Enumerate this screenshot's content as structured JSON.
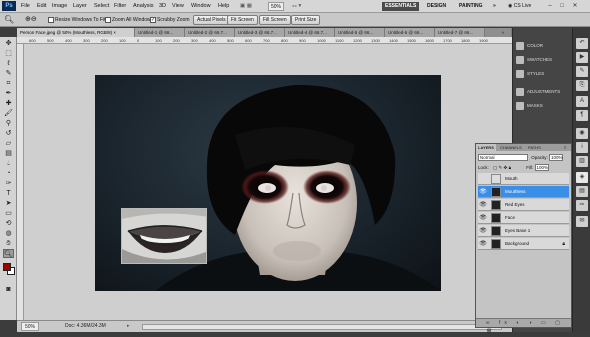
{
  "menubar": {
    "logo": "Ps",
    "items": [
      "File",
      "Edit",
      "Image",
      "Layer",
      "Select",
      "Filter",
      "Analysis",
      "3D",
      "View",
      "Window",
      "Help"
    ],
    "zoom": "50%",
    "workspaces": [
      "ESSENTIALS",
      "DESIGN",
      "PAINTING"
    ],
    "cs_live": "CS Live",
    "window_controls": [
      "–",
      "□",
      "✕"
    ]
  },
  "options": {
    "resize_windows": "Resize Windows To Fit",
    "zoom_all": "Zoom All Windows",
    "scrubby_zoom": "Scrubby Zoom",
    "actual_pixels": "Actual Pixels",
    "fit_screen": "Fit Screen",
    "fill_screen": "Fill Screen",
    "print_size": "Print Size"
  },
  "tabs": [
    "Person Face.jpeg @ 50% (Mouthless, RGB/8) ×",
    "Untitled-1 @ 66...",
    "Untitled-2 @ 66.7...",
    "Untitled-3 @ 66.7...",
    "Untitled-4 @ 66.7...",
    "Untitled-5 @ 66...",
    "Untitled-6 @ 66...",
    "Untitled-7 @ 66..."
  ],
  "ruler": {
    "ticks": [
      "600",
      "500",
      "400",
      "300",
      "200",
      "100",
      "0",
      "100",
      "200",
      "300",
      "400",
      "500",
      "600",
      "700",
      "800",
      "900",
      "1000",
      "1100",
      "1200",
      "1300",
      "1400",
      "1500",
      "1600",
      "1700",
      "1800",
      "1900"
    ]
  },
  "status": {
    "zoom": "50%",
    "doc": "Doc: 4.36M/24.3M"
  },
  "dock": {
    "group1": [
      "COLOR",
      "SWATCHES",
      "STYLES"
    ],
    "group2": [
      "ADJUSTMENTS",
      "MASKS"
    ]
  },
  "layers_panel": {
    "tabs": [
      "LAYERS",
      "CHANNELS",
      "PATHS"
    ],
    "blend_mode": "Normal",
    "opacity_label": "Opacity:",
    "opacity": "100%",
    "lock_label": "Lock:",
    "fill_label": "Fill:",
    "fill": "100%",
    "layers": [
      {
        "name": "Mouth"
      },
      {
        "name": "Mouthless"
      },
      {
        "name": "Red Eyes"
      },
      {
        "name": "Face"
      },
      {
        "name": "Eyes Base 1"
      },
      {
        "name": "Background"
      }
    ],
    "footer_icons": "∞ fx ◐ ◑ ▭ ▢ 🗑"
  },
  "colors": {
    "accent": "#3b8ee8",
    "foreground_swatch": "#9b0000",
    "background_swatch": "#ffffff"
  }
}
